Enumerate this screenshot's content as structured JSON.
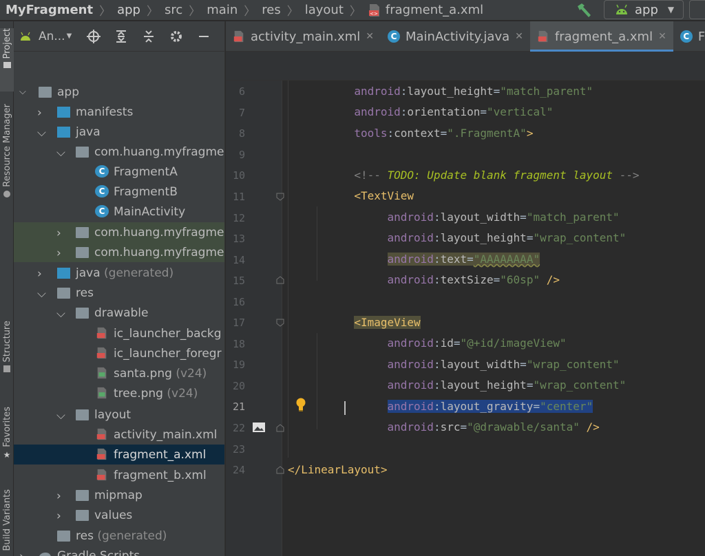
{
  "topbar": {
    "breadcrumbs": [
      "MyFragment",
      "app",
      "src",
      "main",
      "res",
      "layout",
      "fragment_a.xml"
    ],
    "run_config": "app"
  },
  "tool_strip": {
    "tabs": [
      "Project",
      "Resource Manager",
      "Structure",
      "Favorites",
      "Build Variants"
    ]
  },
  "project_panel": {
    "view_label": "An..."
  },
  "tree": [
    {
      "label": "app",
      "suffix": ""
    },
    {
      "label": "manifests",
      "suffix": ""
    },
    {
      "label": "java",
      "suffix": ""
    },
    {
      "label": "com.huang.myfragme",
      "suffix": ""
    },
    {
      "label": "FragmentA",
      "suffix": ""
    },
    {
      "label": "FragmentB",
      "suffix": ""
    },
    {
      "label": "MainActivity",
      "suffix": ""
    },
    {
      "label": "com.huang.myfragme",
      "suffix": ""
    },
    {
      "label": "com.huang.myfragme",
      "suffix": ""
    },
    {
      "label": "java",
      "suffix": "(generated)"
    },
    {
      "label": "res",
      "suffix": ""
    },
    {
      "label": "drawable",
      "suffix": ""
    },
    {
      "label": "ic_launcher_backg",
      "suffix": ""
    },
    {
      "label": "ic_launcher_foregr",
      "suffix": ""
    },
    {
      "label": "santa.png",
      "suffix": "(v24)"
    },
    {
      "label": "tree.png",
      "suffix": "(v24)"
    },
    {
      "label": "layout",
      "suffix": ""
    },
    {
      "label": "activity_main.xml",
      "suffix": ""
    },
    {
      "label": "fragment_a.xml",
      "suffix": ""
    },
    {
      "label": "fragment_b.xml",
      "suffix": ""
    },
    {
      "label": "mipmap",
      "suffix": ""
    },
    {
      "label": "values",
      "suffix": ""
    },
    {
      "label": "res",
      "suffix": "(generated)"
    },
    {
      "label": "Gradle Scripts",
      "suffix": ""
    }
  ],
  "editor_tabs": [
    "activity_main.xml",
    "MainActivity.java",
    "fragment_a.xml",
    "Fra"
  ],
  "line_numbers": [
    "6",
    "7",
    "8",
    "9",
    "10",
    "11",
    "12",
    "13",
    "14",
    "15",
    "16",
    "17",
    "18",
    "19",
    "20",
    "21",
    "22",
    "23",
    "24"
  ],
  "code": {
    "l6": {
      "ns": "android",
      "attr": "layout_height",
      "val": "\"match_parent\""
    },
    "l7": {
      "ns": "android",
      "attr": "orientation",
      "val": "\"vertical\""
    },
    "l8": {
      "ns": "tools",
      "attr": "context",
      "val": "\".FragmentA\"",
      "end": ">"
    },
    "l10": {
      "open": "<!-- ",
      "todo": "TODO: Update blank fragment layout",
      "close": " -->"
    },
    "l11": {
      "tag": "<TextView"
    },
    "l12": {
      "ns": "android",
      "attr": "layout_width",
      "val": "\"match_parent\""
    },
    "l13": {
      "ns": "android",
      "attr": "layout_height",
      "val": "\"wrap_content\""
    },
    "l14": {
      "ns": "android",
      "attr": "text",
      "val": "\"AAAAAAAA\""
    },
    "l15": {
      "ns": "android",
      "attr": "textSize",
      "val": "\"60sp\"",
      "end": " />"
    },
    "l17": {
      "tag": "<ImageView"
    },
    "l18": {
      "ns": "android",
      "attr": "id",
      "val": "\"@+id/imageView\""
    },
    "l19": {
      "ns": "android",
      "attr": "layout_width",
      "val": "\"wrap_content\""
    },
    "l20": {
      "ns": "android",
      "attr": "layout_height",
      "val": "\"wrap_content\""
    },
    "l21": {
      "ns": "android",
      "attr": "layout_gravity",
      "val": "\"center\""
    },
    "l22": {
      "ns": "android",
      "attr": "src",
      "val": "\"@drawable/santa\"",
      "end": " />"
    },
    "l24": {
      "tag": "</LinearLayout>"
    }
  },
  "colors": {
    "accent": "#4a88c7",
    "xml_tag": "#e8bf6a",
    "string_value": "#6a8759",
    "namespace": "#9876aa",
    "todo": "#a8c023"
  }
}
